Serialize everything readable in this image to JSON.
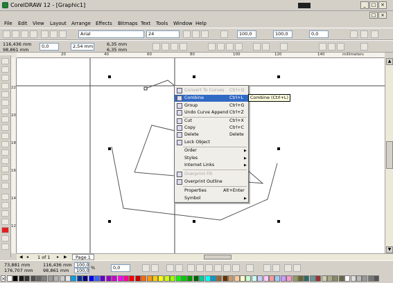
{
  "window": {
    "title": "CorelDRAW 12 - [Graphic1]",
    "controls": [
      "_",
      "□",
      "×"
    ]
  },
  "menubar": {
    "items": [
      "File",
      "Edit",
      "View",
      "Layout",
      "Arrange",
      "Effects",
      "Bitmaps",
      "Text",
      "Tools",
      "Window",
      "Help"
    ]
  },
  "standard_toolbar": {
    "font_name": "Arial",
    "font_size": "24",
    "zoom_a": "100,0",
    "zoom_b": "100,0",
    "angle": "0,0"
  },
  "property_bar": {
    "x": "116,436 mm",
    "y": "98,861 mm",
    "rotation": "0,0",
    "nudge": "2,54 mm",
    "dup_x": "6,35 mm",
    "dup_y": "6,35 mm"
  },
  "ruler": {
    "unit": "millimeters",
    "h_labels": [
      "20",
      "40",
      "60",
      "80",
      "100",
      "120",
      "140",
      "160",
      "180",
      "200"
    ],
    "v_labels": [
      "220",
      "200",
      "180",
      "160",
      "140",
      "120",
      "100",
      "80"
    ]
  },
  "context_menu": {
    "items": [
      {
        "label": "Convert To Curves",
        "shortcut": "Ctrl+Q",
        "disabled": true,
        "icon": "convert-curves-icon"
      },
      {
        "label": "Combine",
        "shortcut": "Ctrl+L",
        "highlighted": true,
        "icon": "combine-icon"
      },
      {
        "label": "Group",
        "shortcut": "Ctrl+G",
        "icon": "group-icon"
      },
      {
        "label": "Undo Curve Append",
        "shortcut": "Ctrl+Z",
        "icon": "undo-icon"
      },
      {
        "label": "Cut",
        "shortcut": "Ctrl+X",
        "icon": "cut-icon"
      },
      {
        "label": "Copy",
        "shortcut": "Ctrl+C",
        "icon": "copy-icon"
      },
      {
        "label": "Delete",
        "shortcut": "Delete",
        "icon": "delete-icon"
      },
      {
        "label": "Lock Object",
        "shortcut": "",
        "icon": "lock-icon"
      },
      {
        "label": "Order",
        "submenu": true
      },
      {
        "label": "Styles",
        "submenu": true
      },
      {
        "label": "Internet Links",
        "submenu": true
      },
      {
        "label": "Overprint Fill",
        "disabled": true,
        "icon": "overprint-fill-icon"
      },
      {
        "label": "Overprint Outline",
        "icon": "overprint-outline-icon"
      },
      {
        "label": "Properties",
        "shortcut": "Alt+Enter"
      },
      {
        "label": "Symbol",
        "submenu": true
      }
    ]
  },
  "tooltip": {
    "text": "Combine (Ctrl+L)"
  },
  "page_nav": {
    "page_count": "1 of 1",
    "page_tab": "Page 1"
  },
  "statusbar": {
    "x": "73,881 mm",
    "y": "176,707 mm",
    "w": "116,436 mm",
    "h": "98,861 mm",
    "scale_x": "100,0",
    "scale_y": "100,0",
    "lock": "%",
    "angle": "0,0"
  },
  "palette": {
    "colors": [
      "#ffffff",
      "#000000",
      "#1a1a1a",
      "#333333",
      "#4d4d4d",
      "#666666",
      "#808080",
      "#999999",
      "#b3b3b3",
      "#cccccc",
      "#e6e6e6",
      "#00a0e9",
      "#003399",
      "#000080",
      "#0000ff",
      "#3366ff",
      "#6600cc",
      "#9900cc",
      "#cc00cc",
      "#ff00ff",
      "#ff0099",
      "#ff0000",
      "#cc0000",
      "#ff6600",
      "#ff9900",
      "#ffcc00",
      "#ffff00",
      "#ccff00",
      "#99ff00",
      "#00ff00",
      "#00cc00",
      "#009900",
      "#006600",
      "#00cc99",
      "#00ffff",
      "#0099cc",
      "#996633",
      "#663300",
      "#cc9966",
      "#ffcc99",
      "#ffffcc",
      "#ccffcc",
      "#ccffff",
      "#ccccff",
      "#ffccff",
      "#ff9999",
      "#99ccff",
      "#cc99ff",
      "#ff99cc",
      "#999966",
      "#666633",
      "#336666",
      "#669999",
      "#993333",
      "#ccccaa",
      "#aaaa88",
      "#888866",
      "#666644",
      "#ffffff",
      "#dddddd",
      "#bbbbbb",
      "#999999",
      "#777777",
      "#555555"
    ]
  }
}
